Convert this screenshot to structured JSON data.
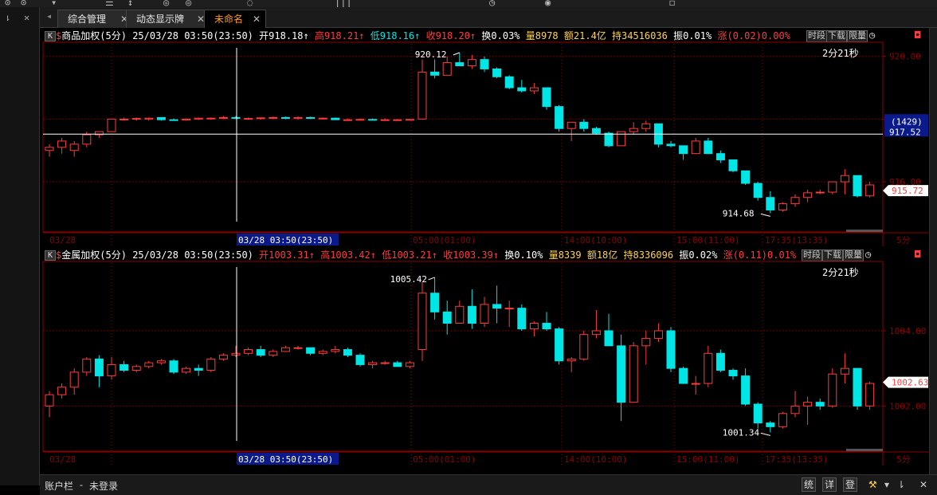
{
  "colors": {
    "up": "#ff3b3b",
    "down": "#00e5e5",
    "grid": "#8b0000",
    "white": "#ffffff",
    "orange": "#ff9b1a"
  },
  "tabs": [
    {
      "label": "综合管理"
    },
    {
      "label": "动态显示牌"
    },
    {
      "label": "未命名",
      "active": true
    }
  ],
  "status": {
    "account_bar": "账户栏",
    "separator": "-",
    "login_state": "未登录",
    "btn_tong": "统",
    "btn_xiang": "详",
    "btn_deng": "登"
  },
  "panel1": {
    "badge": "K",
    "name": "商品加权(5分)",
    "datetime": "25/03/28 03:50(23:50)",
    "open": "开918.18↑",
    "high": "高918.21↑",
    "low": "低918.16↑",
    "close": "收918.20↑",
    "turnover": "换0.03%",
    "volume": "量8978",
    "amount": "额21.4亿",
    "hold": "持34516036",
    "amplitude": "振0.01%",
    "change": "涨(0.02)0.00%",
    "btn_shiduan": "时段",
    "btn_xiazai": "下载",
    "btn_xianliang": "限量",
    "countdown": "2分21秒",
    "price_ticks": [
      "920.00",
      "918.00",
      "916.00"
    ],
    "crosshair_label": "(1429)",
    "crosshair_price": "917.52",
    "last_price": "915.72",
    "high_label": "920.12",
    "low_label": "914.68",
    "time_labels": [
      "03/28",
      "03:00(23:00)",
      "05:00(01:00)",
      "14:00(10:00)",
      "15:00(11:00)",
      "17:35(13:35)"
    ],
    "cursor_time": "03/28 03:50(23:50)",
    "period": "5分"
  },
  "panel2": {
    "badge": "K",
    "name": "金属加权(5分)",
    "datetime": "25/03/28 03:50(23:50)",
    "open": "开1003.31↑",
    "high": "高1003.42↑",
    "low": "低1003.21↑",
    "close": "收1003.39↑",
    "turnover": "换0.10%",
    "volume": "量8339",
    "amount": "额18亿",
    "hold": "持8336096",
    "amplitude": "振0.02%",
    "change": "涨(0.11)0.01%",
    "btn_shiduan": "时段",
    "btn_xiazai": "下载",
    "btn_xianliang": "限量",
    "countdown": "2分21秒",
    "price_ticks": [
      "1004.00",
      "1002.00"
    ],
    "last_price": "1002.63",
    "high_label": "1005.42",
    "low_label": "1001.34",
    "time_labels": [
      "03/28",
      "03:00(23:00)",
      "05:00(01:00)",
      "14:00(10:00)",
      "15:00(11:00)",
      "17:35(13:35)"
    ],
    "cursor_time": "03/28 03:50(23:50)",
    "period": "5分"
  },
  "chart_data": [
    {
      "type": "candlestick",
      "title": "商品加权(5分)",
      "ylim": [
        914.4,
        920.4
      ],
      "candles": [
        [
          917.0,
          917.2,
          916.8,
          917.1
        ],
        [
          917.1,
          917.4,
          916.9,
          917.3
        ],
        [
          917.0,
          917.3,
          916.8,
          917.2
        ],
        [
          917.2,
          917.6,
          917.1,
          917.5
        ],
        [
          917.5,
          917.6,
          917.4,
          917.6
        ],
        [
          917.6,
          918.0,
          917.6,
          918.0
        ],
        [
          918.0,
          918.05,
          917.95,
          918.0
        ],
        [
          918.0,
          918.05,
          917.95,
          918.02
        ],
        [
          918.0,
          918.05,
          917.95,
          918.03
        ],
        [
          918.05,
          918.05,
          917.95,
          917.98
        ],
        [
          917.98,
          918.02,
          917.95,
          917.97
        ],
        [
          917.97,
          918.02,
          917.95,
          918.0
        ],
        [
          918.0,
          918.05,
          917.97,
          918.03
        ],
        [
          918.03,
          918.05,
          917.98,
          918.03
        ],
        [
          918.03,
          918.1,
          918.0,
          918.05
        ],
        [
          918.05,
          918.1,
          918.0,
          918.02
        ],
        [
          918.02,
          918.05,
          917.98,
          918.02
        ],
        [
          918.02,
          918.05,
          917.98,
          918.04
        ],
        [
          918.04,
          918.08,
          918.0,
          918.05
        ],
        [
          918.05,
          918.08,
          918.0,
          918.02
        ],
        [
          918.02,
          918.08,
          917.98,
          918.05
        ],
        [
          918.05,
          918.08,
          918.0,
          918.02
        ],
        [
          918.02,
          918.05,
          917.98,
          918.03
        ],
        [
          918.03,
          918.05,
          917.98,
          917.98
        ],
        [
          917.98,
          918.02,
          917.96,
          917.98
        ],
        [
          917.98,
          918.02,
          917.96,
          917.99
        ],
        [
          917.99,
          918.02,
          917.96,
          917.98
        ],
        [
          917.98,
          918.02,
          917.96,
          917.98
        ],
        [
          917.98,
          918.0,
          917.96,
          917.98
        ],
        [
          917.98,
          918.0,
          917.96,
          917.99
        ],
        [
          918.0,
          919.9,
          918.0,
          919.5
        ],
        [
          919.5,
          919.9,
          919.3,
          919.4
        ],
        [
          919.4,
          920.0,
          919.4,
          919.8
        ],
        [
          919.8,
          920.12,
          919.7,
          919.7
        ],
        [
          919.7,
          920.05,
          919.6,
          919.9
        ],
        [
          919.9,
          920.0,
          919.5,
          919.6
        ],
        [
          919.6,
          919.65,
          919.3,
          919.35
        ],
        [
          919.35,
          919.4,
          918.95,
          919.0
        ],
        [
          919.0,
          919.25,
          918.85,
          918.9
        ],
        [
          918.9,
          919.15,
          918.8,
          919.0
        ],
        [
          919.0,
          919.0,
          918.3,
          918.4
        ],
        [
          918.4,
          918.45,
          917.6,
          917.7
        ],
        [
          917.7,
          917.9,
          917.3,
          917.9
        ],
        [
          917.9,
          918.0,
          917.6,
          917.7
        ],
        [
          917.7,
          917.75,
          917.5,
          917.55
        ],
        [
          917.55,
          917.6,
          917.1,
          917.15
        ],
        [
          917.15,
          917.6,
          917.15,
          917.6
        ],
        [
          917.6,
          917.9,
          917.5,
          917.7
        ],
        [
          917.7,
          917.95,
          917.6,
          917.85
        ],
        [
          917.85,
          917.85,
          917.1,
          917.2
        ],
        [
          917.2,
          917.3,
          917.1,
          917.15
        ],
        [
          917.15,
          917.15,
          916.7,
          916.9
        ],
        [
          916.9,
          917.4,
          916.9,
          917.3
        ],
        [
          917.3,
          917.4,
          916.9,
          916.9
        ],
        [
          916.9,
          917.0,
          916.6,
          916.7
        ],
        [
          916.7,
          916.7,
          916.3,
          916.35
        ],
        [
          916.35,
          916.35,
          915.9,
          915.95
        ],
        [
          915.95,
          916.0,
          915.4,
          915.5
        ],
        [
          915.5,
          915.7,
          915.0,
          915.1
        ],
        [
          915.1,
          915.35,
          915.05,
          915.3
        ],
        [
          915.3,
          915.6,
          915.2,
          915.5
        ],
        [
          915.5,
          915.75,
          915.35,
          915.65
        ],
        [
          915.65,
          915.75,
          915.6,
          915.67
        ],
        [
          915.67,
          916.0,
          915.6,
          916.0
        ],
        [
          916.0,
          916.4,
          915.6,
          916.2
        ],
        [
          916.2,
          916.2,
          915.5,
          915.55
        ],
        [
          915.55,
          916.0,
          915.5,
          915.9
        ]
      ]
    },
    {
      "type": "candlestick",
      "title": "金属加权(5分)",
      "ylim": [
        1000.8,
        1005.8
      ],
      "candles": [
        [
          1002.0,
          1002.4,
          1001.7,
          1002.3
        ],
        [
          1002.3,
          1002.6,
          1002.2,
          1002.5
        ],
        [
          1002.5,
          1003.0,
          1002.3,
          1002.9
        ],
        [
          1002.9,
          1003.3,
          1002.8,
          1003.25
        ],
        [
          1003.25,
          1003.35,
          1002.5,
          1002.8
        ],
        [
          1002.8,
          1003.3,
          1002.7,
          1003.1
        ],
        [
          1003.1,
          1003.2,
          1002.9,
          1002.95
        ],
        [
          1002.95,
          1003.1,
          1002.9,
          1003.05
        ],
        [
          1003.05,
          1003.2,
          1003.0,
          1003.15
        ],
        [
          1003.15,
          1003.25,
          1003.1,
          1003.2
        ],
        [
          1003.2,
          1003.25,
          1002.85,
          1002.9
        ],
        [
          1002.9,
          1003.05,
          1002.85,
          1003.0
        ],
        [
          1003.0,
          1003.1,
          1002.8,
          1002.95
        ],
        [
          1002.95,
          1003.3,
          1002.9,
          1003.25
        ],
        [
          1003.25,
          1003.4,
          1003.2,
          1003.35
        ],
        [
          1003.35,
          1003.6,
          1003.3,
          1003.4
        ],
        [
          1003.4,
          1003.55,
          1003.35,
          1003.5
        ],
        [
          1003.5,
          1003.6,
          1003.3,
          1003.35
        ],
        [
          1003.35,
          1003.5,
          1003.3,
          1003.45
        ],
        [
          1003.45,
          1003.6,
          1003.45,
          1003.55
        ],
        [
          1003.55,
          1003.6,
          1003.5,
          1003.55
        ],
        [
          1003.55,
          1003.55,
          1003.35,
          1003.4
        ],
        [
          1003.4,
          1003.5,
          1003.35,
          1003.45
        ],
        [
          1003.45,
          1003.6,
          1003.4,
          1003.5
        ],
        [
          1003.5,
          1003.55,
          1003.3,
          1003.35
        ],
        [
          1003.35,
          1003.4,
          1003.05,
          1003.1
        ],
        [
          1003.1,
          1003.2,
          1003.0,
          1003.15
        ],
        [
          1003.15,
          1003.2,
          1003.1,
          1003.15
        ],
        [
          1003.15,
          1003.2,
          1003.05,
          1003.05
        ],
        [
          1003.05,
          1003.2,
          1003.0,
          1003.15
        ],
        [
          1003.5,
          1005.3,
          1003.2,
          1005.0
        ],
        [
          1005.0,
          1005.42,
          1004.3,
          1004.5
        ],
        [
          1004.5,
          1004.8,
          1003.9,
          1004.2
        ],
        [
          1004.2,
          1004.8,
          1004.2,
          1004.65
        ],
        [
          1004.65,
          1005.1,
          1004.05,
          1004.2
        ],
        [
          1004.2,
          1004.9,
          1004.1,
          1004.7
        ],
        [
          1004.7,
          1005.2,
          1004.2,
          1004.6
        ],
        [
          1004.6,
          1004.8,
          1004.1,
          1004.6
        ],
        [
          1004.6,
          1004.7,
          1004.0,
          1004.05
        ],
        [
          1004.05,
          1004.25,
          1003.85,
          1004.2
        ],
        [
          1004.2,
          1004.5,
          1004.0,
          1004.05
        ],
        [
          1004.05,
          1004.1,
          1003.1,
          1003.2
        ],
        [
          1003.2,
          1003.3,
          1002.9,
          1003.25
        ],
        [
          1003.25,
          1004.0,
          1003.2,
          1003.9
        ],
        [
          1003.9,
          1004.55,
          1003.8,
          1004.0
        ],
        [
          1004.0,
          1004.45,
          1003.7,
          1003.6
        ],
        [
          1003.6,
          1003.9,
          1001.6,
          1002.1
        ],
        [
          1002.1,
          1003.7,
          1002.1,
          1003.6
        ],
        [
          1003.6,
          1004.0,
          1003.1,
          1003.8
        ],
        [
          1003.8,
          1004.2,
          1003.7,
          1004.0
        ],
        [
          1004.0,
          1004.1,
          1002.9,
          1003.0
        ],
        [
          1003.0,
          1003.05,
          1002.6,
          1002.6
        ],
        [
          1002.6,
          1002.8,
          1002.3,
          1002.6
        ],
        [
          1002.6,
          1003.6,
          1002.5,
          1003.4
        ],
        [
          1003.4,
          1003.5,
          1002.9,
          1002.95
        ],
        [
          1002.95,
          1003.0,
          1002.7,
          1002.8
        ],
        [
          1002.8,
          1003.0,
          1002.0,
          1002.05
        ],
        [
          1002.05,
          1002.1,
          1001.4,
          1001.55
        ],
        [
          1001.55,
          1001.6,
          1001.3,
          1001.45
        ],
        [
          1001.45,
          1001.85,
          1001.4,
          1001.8
        ],
        [
          1001.8,
          1002.4,
          1001.7,
          1002.0
        ],
        [
          1002.0,
          1002.25,
          1001.5,
          1002.1
        ],
        [
          1002.1,
          1002.2,
          1001.9,
          1002.0
        ],
        [
          1002.0,
          1003.0,
          1001.95,
          1002.85
        ],
        [
          1002.85,
          1003.4,
          1002.6,
          1003.0
        ],
        [
          1003.0,
          1003.0,
          1001.9,
          1002.0
        ],
        [
          1002.0,
          1002.65,
          1001.9,
          1002.6
        ]
      ]
    }
  ]
}
